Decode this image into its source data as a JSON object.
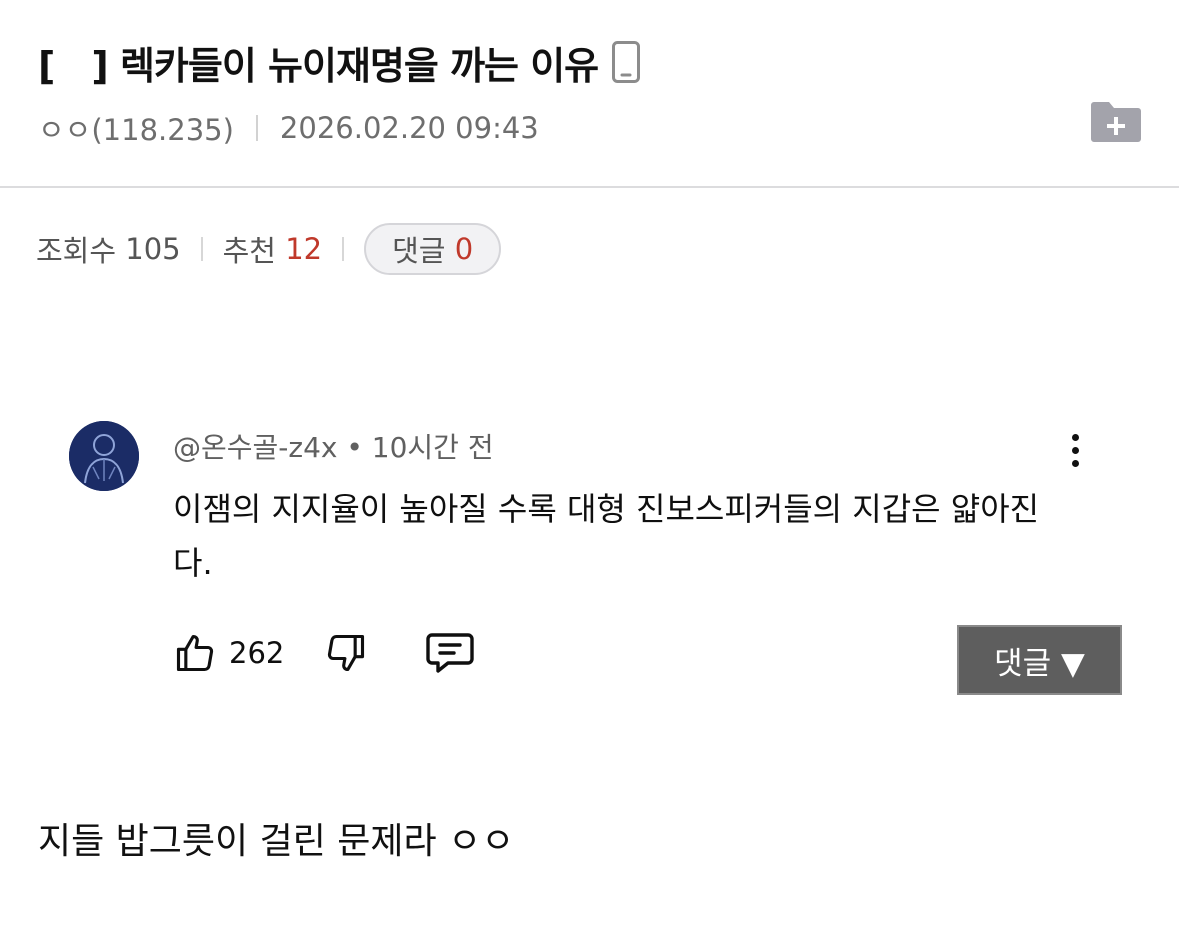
{
  "post": {
    "title": "[　] 렉카들이 뉴이재명을 까는 이유",
    "author": "ㅇㅇ(118.235)",
    "datetime": "2026.02.20 09:43",
    "icons": {
      "device": "phone-icon",
      "scrap": "folder-plus-icon"
    }
  },
  "stats": {
    "views_label": "조회수",
    "views": "105",
    "recommend_label": "추천",
    "recommend": "12",
    "comments_label": "댓글",
    "comments": "0",
    "accent_color": "#c0392b"
  },
  "embedded_comment": {
    "handle": "@온수골-z4x",
    "time": "10시간 전",
    "text": "이잼의 지지율이 높아질 수록 대형 진보스피커들의 지갑은 얇아진다.",
    "likes": "262",
    "reply_button": "댓글 ▼",
    "icons": [
      "thumbs-up-icon",
      "thumbs-down-icon",
      "reply-icon",
      "more-vert-icon"
    ]
  },
  "body": {
    "text": "지들 밥그릇이 걸린 문제라 ㅇㅇ"
  }
}
